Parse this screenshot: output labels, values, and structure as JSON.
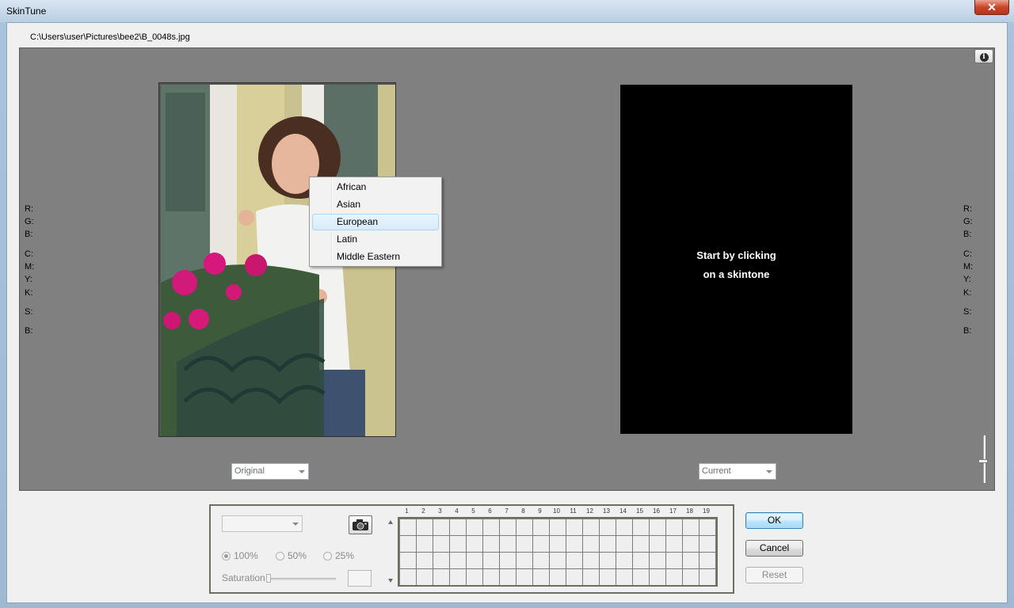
{
  "window": {
    "title": "SkinTune",
    "close_glyph": "✕"
  },
  "file_path": "C:\\Users\\user\\Pictures\\bee2\\B_0048s.jpg",
  "readouts": {
    "left": [
      "R:",
      "G:",
      "B:",
      "C:",
      "M:",
      "Y:",
      "K:",
      "S:",
      "B:"
    ],
    "right": [
      "R:",
      "G:",
      "B:",
      "C:",
      "M:",
      "Y:",
      "K:",
      "S:",
      "B:"
    ]
  },
  "preview": {
    "original_view_select": "Original",
    "current_view_select": "Current",
    "current_message_line1": "Start by clicking",
    "current_message_line2": "on a skintone",
    "info_glyph": "i"
  },
  "context_menu": {
    "items": [
      "African",
      "Asian",
      "European",
      "Latin",
      "Middle Eastern"
    ],
    "highlighted": "European"
  },
  "bottom": {
    "profile_select": "",
    "radios": [
      {
        "label": "100%",
        "checked": true
      },
      {
        "label": "50%",
        "checked": false
      },
      {
        "label": "25%",
        "checked": false
      }
    ],
    "saturation_label": "Saturation",
    "grid_columns": [
      "1",
      "2",
      "3",
      "4",
      "5",
      "6",
      "7",
      "8",
      "9",
      "10",
      "11",
      "12",
      "13",
      "14",
      "15",
      "16",
      "17",
      "18",
      "19"
    ],
    "grid_rows": 4
  },
  "buttons": {
    "ok": "OK",
    "cancel": "Cancel",
    "reset": "Reset"
  }
}
